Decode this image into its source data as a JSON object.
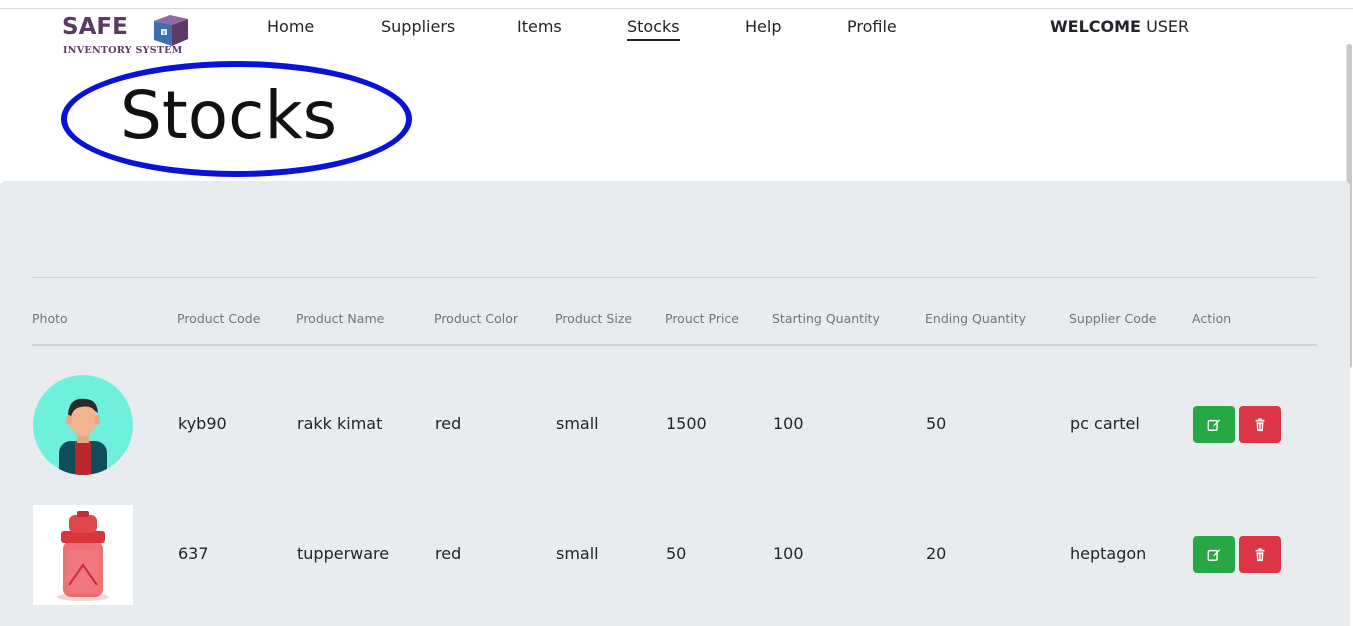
{
  "brand": {
    "name": "SAFE",
    "tagline": "INVENTORY SYSTEM",
    "color": "#5b3a63"
  },
  "nav": {
    "items": [
      {
        "label": "Home"
      },
      {
        "label": "Suppliers"
      },
      {
        "label": "Items"
      },
      {
        "label": "Stocks",
        "active": true
      },
      {
        "label": "Help"
      },
      {
        "label": "Profile"
      }
    ]
  },
  "user": {
    "welcome": "WELCOME",
    "name": "USER"
  },
  "page": {
    "title": "Stocks",
    "highlight_color": "#0a12d8"
  },
  "table": {
    "headers": [
      "Photo",
      "Product Code",
      "Product Name",
      "Product Color",
      "Product Size",
      "Prouct Price",
      "Starting Quantity",
      "Ending Quantity",
      "Supplier Code",
      "Action"
    ],
    "rows": [
      {
        "photo": "avatar-image",
        "product_code": "kyb90",
        "product_name": "rakk kimat",
        "product_color": "red",
        "product_size": "small",
        "price": "1500",
        "starting_quantity": "100",
        "ending_quantity": "50",
        "supplier_code": "pc cartel"
      },
      {
        "photo": "tupperware-image",
        "product_code": "637",
        "product_name": "tupperware",
        "product_color": "red",
        "product_size": "small",
        "price": "50",
        "starting_quantity": "100",
        "ending_quantity": "20",
        "supplier_code": "heptagon"
      }
    ]
  },
  "actions": {
    "edit_icon": "edit-icon",
    "delete_icon": "trash-icon",
    "edit_color": "#28a745",
    "delete_color": "#dc3545"
  },
  "colors": {
    "panel": "#e9ecef",
    "header_text": "#6c757d"
  }
}
